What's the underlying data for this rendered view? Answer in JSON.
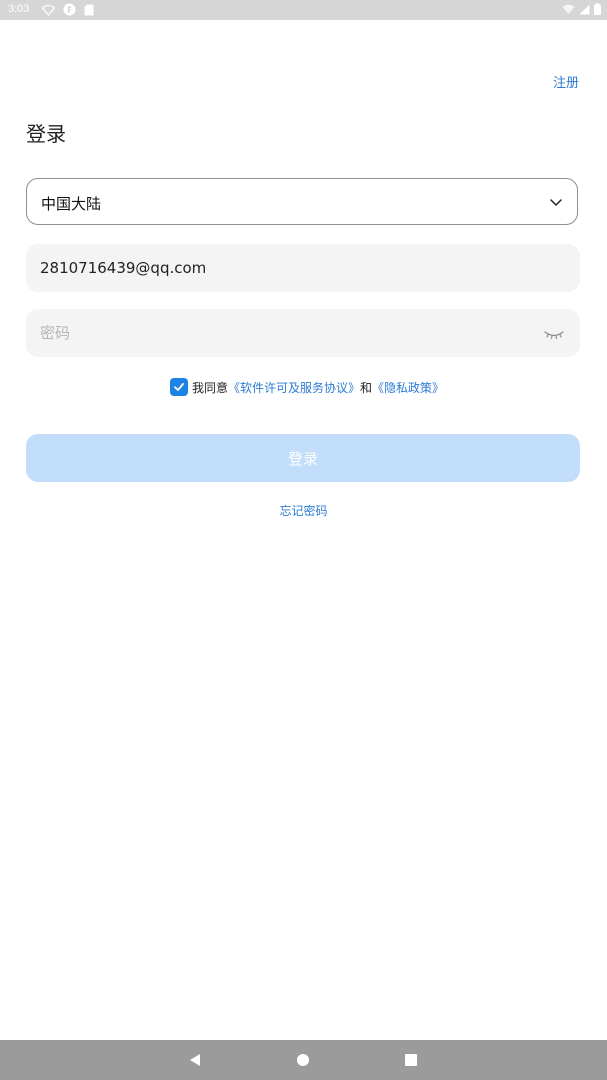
{
  "status_bar": {
    "time": "3:03",
    "left_icons": [
      "wifi-off-icon",
      "app-notification-icon",
      "sd-card-icon"
    ],
    "right_icons": [
      "wifi-icon",
      "signal-icon",
      "battery-icon"
    ]
  },
  "header": {
    "register_label": "注册",
    "title": "登录"
  },
  "form": {
    "region_value": "中国大陆",
    "email_value": "2810716439@qq.com",
    "password_placeholder": "密码",
    "agreement": {
      "checked": true,
      "prefix": "我同意",
      "terms_link": "《软件许可及服务协议》",
      "conjunction": "和",
      "privacy_link": "《隐私政策》"
    },
    "login_label": "登录",
    "forgot_label": "忘记密码"
  },
  "nav_bar": {
    "icons": [
      "back-icon",
      "home-icon",
      "recents-icon"
    ]
  },
  "colors": {
    "accent": "#2c7bd4",
    "checkbox": "#1c82e6",
    "login_button_disabled": "#c2defa",
    "field_background": "#f4f4f4"
  }
}
